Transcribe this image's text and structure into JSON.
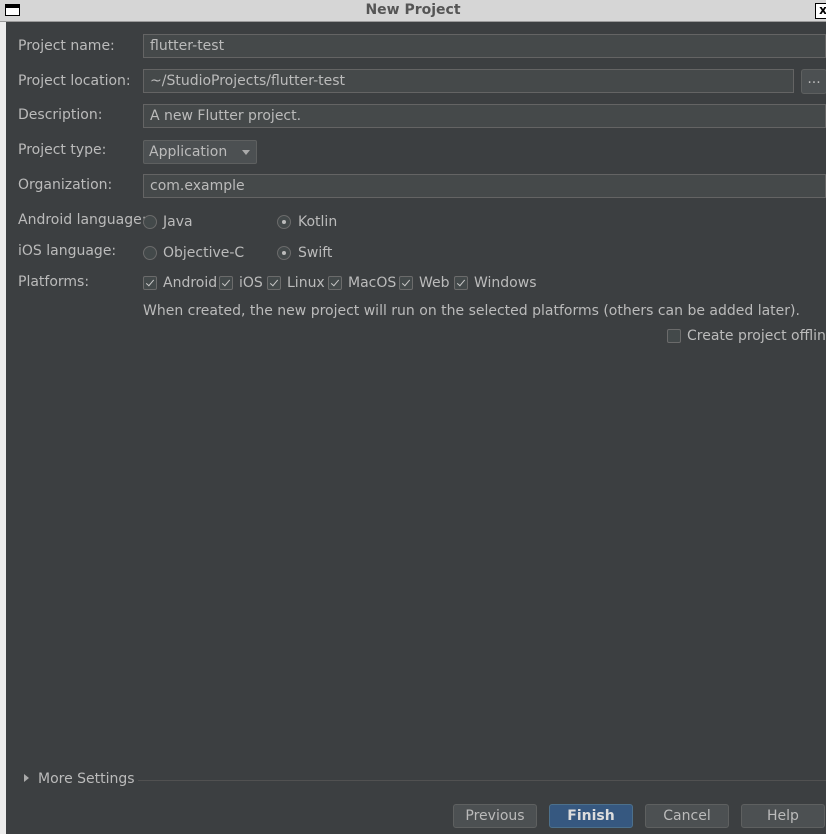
{
  "window": {
    "title": "New Project"
  },
  "form": {
    "project_name": {
      "label": "Project name:",
      "value": "flutter-test"
    },
    "project_location": {
      "label": "Project location:",
      "value": "~/StudioProjects/flutter-test",
      "browse_label": "..."
    },
    "description": {
      "label": "Description:",
      "value": "A new Flutter project."
    },
    "project_type": {
      "label": "Project type:",
      "selected": "Application"
    },
    "organization": {
      "label": "Organization:",
      "value": "com.example"
    },
    "android_language": {
      "label": "Android language:",
      "options": [
        {
          "label": "Java",
          "selected": false
        },
        {
          "label": "Kotlin",
          "selected": true
        }
      ]
    },
    "ios_language": {
      "label": "iOS language:",
      "options": [
        {
          "label": "Objective-C",
          "selected": false
        },
        {
          "label": "Swift",
          "selected": true
        }
      ]
    },
    "platforms": {
      "label": "Platforms:",
      "items": [
        {
          "label": "Android",
          "checked": true
        },
        {
          "label": "iOS",
          "checked": true
        },
        {
          "label": "Linux",
          "checked": true
        },
        {
          "label": "MacOS",
          "checked": true
        },
        {
          "label": "Web",
          "checked": true
        },
        {
          "label": "Windows",
          "checked": true
        }
      ],
      "hint": "When created, the new project will run on the selected platforms (others can be added later)."
    },
    "offline": {
      "label": "Create project offline",
      "checked": false
    }
  },
  "more_settings": {
    "label": "More Settings"
  },
  "buttons": {
    "previous": "Previous",
    "finish": "Finish",
    "cancel": "Cancel",
    "help": "Help"
  }
}
